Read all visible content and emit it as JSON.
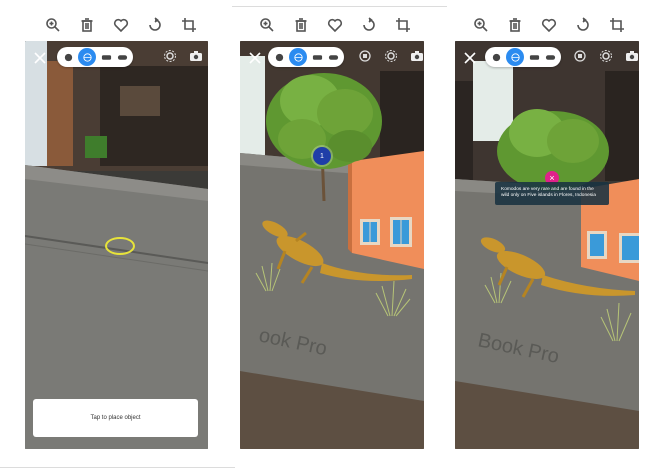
{
  "toolbars": [
    {
      "icons": [
        "zoom-in-icon",
        "trash-icon",
        "heart-icon",
        "rotate-icon",
        "crop-icon"
      ]
    },
    {
      "icons": [
        "zoom-in-icon",
        "trash-icon",
        "heart-icon",
        "rotate-icon",
        "crop-icon"
      ]
    },
    {
      "icons": [
        "zoom-in-icon",
        "trash-icon",
        "heart-icon",
        "rotate-icon",
        "crop-icon"
      ]
    }
  ],
  "colors": {
    "accent": "#2b8bf0",
    "reticle": "#e7e33a",
    "hotspot": "#1f3ea8",
    "close_pink": "#e0218a",
    "building": "#f08e5a",
    "tree": "#6ea338",
    "lizard": "#c9962c"
  },
  "screen1": {
    "place_button_label": "Tap to place object"
  },
  "screen2": {
    "hotspot_label": "1",
    "box_text": "ook Pro"
  },
  "screen3": {
    "info_text": "Komodos are very rare and are found in the wild only on Five islands in Flores, Indonesia",
    "box_text": "Book Pro",
    "close_symbol": "×"
  }
}
